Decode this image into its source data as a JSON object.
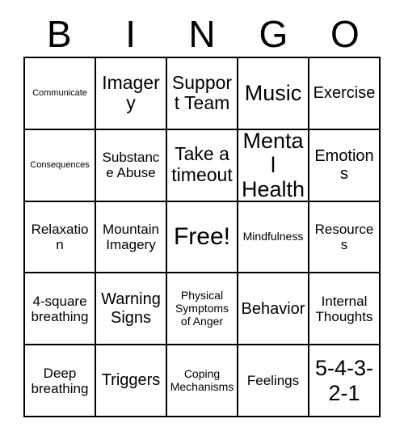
{
  "card": {
    "title_letters": [
      "B",
      "I",
      "N",
      "G",
      "O"
    ],
    "colors": {
      "background": "#ffffff",
      "text": "#000000",
      "grid_line": "#000000"
    },
    "grid": {
      "columns": 5,
      "rows": 5,
      "cells": [
        [
          {
            "label": "Communicate",
            "size": "xs"
          },
          {
            "label": "Imagery",
            "size": "xl"
          },
          {
            "label": "Support Team",
            "size": "xl"
          },
          {
            "label": "Music",
            "size": "xxl"
          },
          {
            "label": "Exercise",
            "size": "l"
          }
        ],
        [
          {
            "label": "Consequences",
            "size": "xs"
          },
          {
            "label": "Substance Abuse",
            "size": "m"
          },
          {
            "label": "Take a timeout",
            "size": "xl"
          },
          {
            "label": "Mental Health",
            "size": "xxl"
          },
          {
            "label": "Emotions",
            "size": "l"
          }
        ],
        [
          {
            "label": "Relaxation",
            "size": "m"
          },
          {
            "label": "Mountain Imagery",
            "size": "m"
          },
          {
            "label": "Free!",
            "size": "free"
          },
          {
            "label": "Mindfulness",
            "size": "s"
          },
          {
            "label": "Resources",
            "size": "m"
          }
        ],
        [
          {
            "label": "4-square breathing",
            "size": "m"
          },
          {
            "label": "Warning Signs",
            "size": "l"
          },
          {
            "label": "Physical Symptoms of Anger",
            "size": "s"
          },
          {
            "label": "Behavior",
            "size": "l"
          },
          {
            "label": "Internal Thoughts",
            "size": "m"
          }
        ],
        [
          {
            "label": "Deep breathing",
            "size": "m"
          },
          {
            "label": "Triggers",
            "size": "l"
          },
          {
            "label": "Coping Mechanisms",
            "size": "s"
          },
          {
            "label": "Feelings",
            "size": "m"
          },
          {
            "label": "5-4-3-2-1",
            "size": "xxl"
          }
        ]
      ]
    }
  }
}
